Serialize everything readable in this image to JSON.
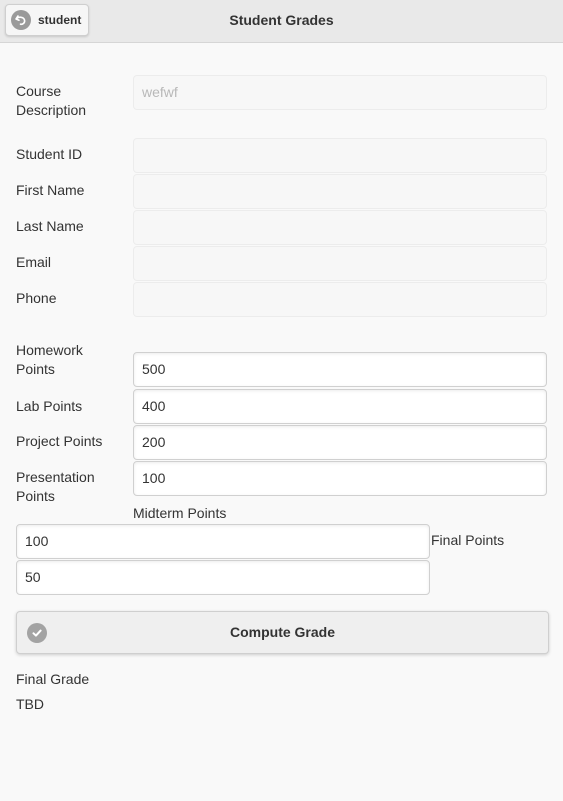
{
  "header": {
    "back_label": "student",
    "title": "Student Grades"
  },
  "fields": {
    "course_description": {
      "label": "Course Description",
      "value": "wefwf"
    },
    "student_id": {
      "label": "Student ID",
      "value": ""
    },
    "first_name": {
      "label": "First Name",
      "value": ""
    },
    "last_name": {
      "label": "Last Name",
      "value": ""
    },
    "email": {
      "label": "Email",
      "value": ""
    },
    "phone": {
      "label": "Phone",
      "value": ""
    },
    "homework_points": {
      "label": "Homework Points",
      "value": "500"
    },
    "lab_points": {
      "label": "Lab Points",
      "value": "400"
    },
    "project_points": {
      "label": "Project Points",
      "value": "200"
    },
    "presentation_points": {
      "label": "Presentation Points",
      "value": "100"
    },
    "midterm_points": {
      "label": "Midterm Points",
      "value": "100"
    },
    "final_points": {
      "label": "Final Points",
      "value": "50"
    }
  },
  "compute_button": {
    "label": "Compute Grade",
    "icon": "check-icon"
  },
  "result": {
    "label": "Final Grade",
    "value": "TBD"
  },
  "icons": {
    "back": "back-arrow-icon"
  }
}
